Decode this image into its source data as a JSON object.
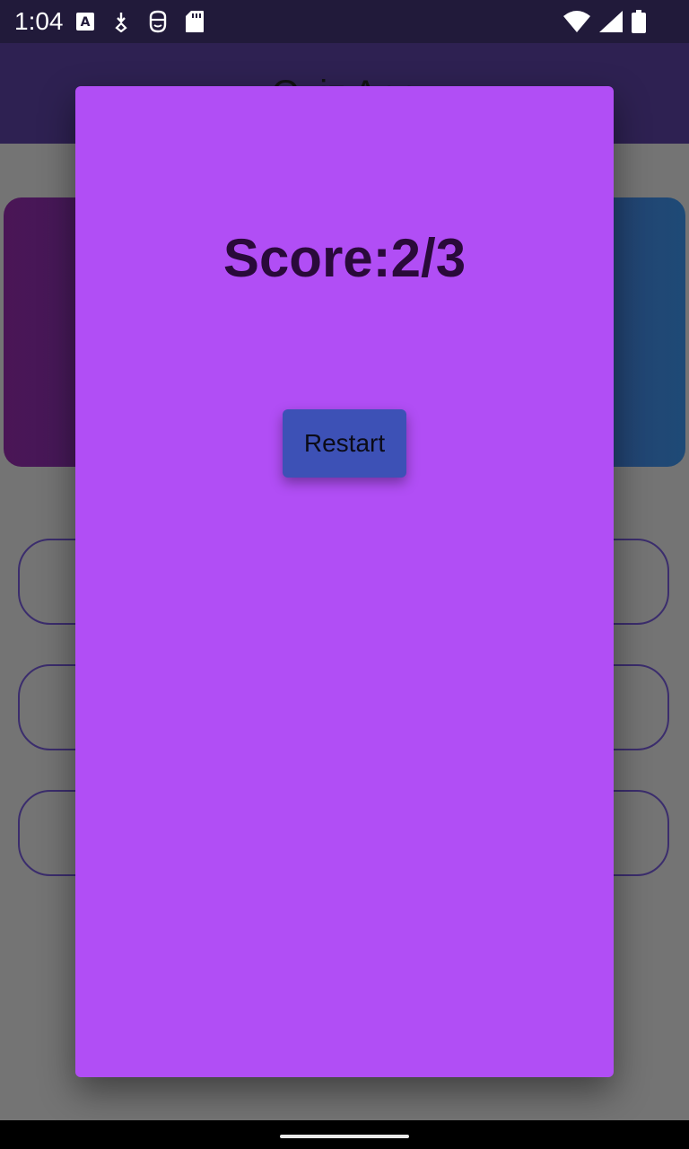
{
  "status_bar": {
    "time": "1:04",
    "icons_left": [
      "font-a-icon",
      "download-diamond-icon",
      "privacy-face-icon",
      "sd-card-icon"
    ],
    "icons_right": [
      "wifi-icon",
      "cellular-signal-icon",
      "battery-icon"
    ]
  },
  "app_bar": {
    "title": "Quiz App"
  },
  "dialog": {
    "score_text": "Score:2/3",
    "restart_label": "Restart"
  },
  "colors": {
    "status_bar": "#211a3a",
    "app_bar": "#2e2152",
    "dialog_bg": "#b14ef5",
    "restart_button": "#3d51b6",
    "score_text": "#2a0a3a"
  }
}
